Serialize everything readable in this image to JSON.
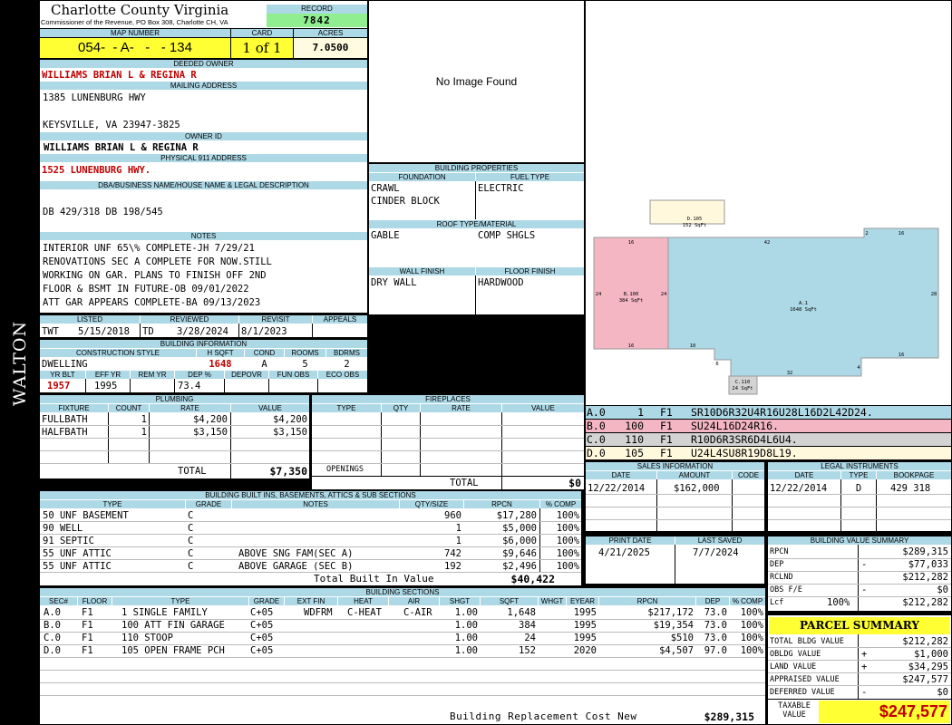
{
  "side_label": "WALTON",
  "header": {
    "county": "Charlotte County Virginia",
    "address": "Commissioner of the Revenue, PO Box 308, Charlotte CH, VA",
    "record_label": "RECORD",
    "record": "7842"
  },
  "map": {
    "map_number_label": "MAP NUMBER",
    "card_label": "CARD",
    "acres_label": "ACRES",
    "map_number": "054-  - A-   -   - 134",
    "card": "1 of 1",
    "acres": "7.0500"
  },
  "owner": {
    "deeded_owner_label": "DEEDED OWNER",
    "deeded_owner": "WILLIAMS BRIAN L & REGINA R",
    "mailing_label": "MAILING ADDRESS",
    "mailing_line1": "1385 LUNENBURG HWY",
    "mailing_line2": "KEYSVILLE, VA 23947-3825",
    "owner_id_label": "OWNER ID",
    "owner_id": "WILLIAMS BRIAN L & REGINA R",
    "physical_label": "PHYSICAL 911 ADDRESS",
    "physical": "1525 LUNENBURG HWY."
  },
  "legal": {
    "label": "DBA/BUSINESS NAME/HOUSE NAME & LEGAL DESCRIPTION",
    "text": "DB 429/318 DB 198/545"
  },
  "notes": {
    "label": "NOTES",
    "lines": [
      "INTERIOR UNF 65\\% COMPLETE-JH 7/29/21",
      "RENOVATIONS SEC A COMPLETE FOR NOW.STILL",
      "WORKING ON GAR. PLANS TO FINISH OFF 2ND",
      "FLOOR & BSMT IN FUTURE-OB 09/01/2022",
      "ATT GAR APPEARS COMPLETE-BA 09/13/2023"
    ]
  },
  "dates": {
    "listed_label": "LISTED",
    "reviewed_label": "REVIEWED",
    "revisit_label": "REVISIT",
    "appeals_label": "APPEALS",
    "listed_by": "TWT",
    "listed": "5/15/2018",
    "reviewed_by": "TD",
    "reviewed": "3/28/2024",
    "revisit": "8/1/2023",
    "appeals": ""
  },
  "building_info": {
    "label": "BUILDING INFORMATION",
    "cs_label": "CONSTRUCTION STYLE",
    "hsqft_label": "H SQFT",
    "cond_label": "COND",
    "rooms_label": "ROOMS",
    "bdrms_label": "BDRMS",
    "style": "DWELLING",
    "hsqft": "1648",
    "cond": "A",
    "rooms": "5",
    "bdrms": "2",
    "yrblt_label": "YR BLT",
    "effyr_label": "EFF YR",
    "remyr_label": "REM YR",
    "dep_label": "DEP %",
    "depovr_label": "DEPOVR",
    "funobs_label": "FUN OBS",
    "ecoobs_label": "ECO OBS",
    "yrblt": "1957",
    "effyr": "1995",
    "remyr": "",
    "dep": "73.4"
  },
  "image": {
    "no_image": "No Image Found"
  },
  "building_props": {
    "label": "BUILDING PROPERTIES",
    "foundation_label": "FOUNDATION",
    "fuel_label": "FUEL TYPE",
    "foundation1": "CRAWL",
    "foundation2": "CINDER BLOCK",
    "fuel": "ELECTRIC",
    "roof_label": "ROOF TYPE/MATERIAL",
    "roof_type": "GABLE",
    "roof_material": "COMP SHGLS",
    "wall_label": "WALL FINISH",
    "floor_label": "FLOOR FINISH",
    "wall": "DRY WALL",
    "floor": "HARDWOOD"
  },
  "sketch": {
    "areas": [
      {
        "id": "D.105",
        "sqft": "152 SqFt",
        "color": "#fff8dc"
      },
      {
        "id": "B.100",
        "sqft": "384 SqFt",
        "color": "#f4b6c2"
      },
      {
        "id": "A.1",
        "sqft": "1648 SqFt",
        "color": "#add8e6"
      },
      {
        "id": "C.110",
        "sqft": "24 SqFt",
        "color": "#d3d3d3"
      }
    ],
    "dims": [
      "16",
      "42",
      "2",
      "16",
      "24",
      "24",
      "28",
      "16",
      "10",
      "16",
      "6",
      "32",
      "4",
      "16",
      "16"
    ]
  },
  "sketch_codes": [
    {
      "sec": "A.0",
      "code": "1",
      "floor": "F1",
      "vectors": "SR10D6R32U4R16U28L16D2L42D24.",
      "color": "#add8e6"
    },
    {
      "sec": "B.0",
      "code": "100",
      "floor": "F1",
      "vectors": "SU24L16D24R16.",
      "color": "#f4b6c2"
    },
    {
      "sec": "C.0",
      "code": "110",
      "floor": "F1",
      "vectors": "R10D6R3SR6D4L6U4.",
      "color": "#d3d3d3"
    },
    {
      "sec": "D.0",
      "code": "105",
      "floor": "F1",
      "vectors": "U24L4SU8R19D8L19.",
      "color": "#fff8dc"
    }
  ],
  "plumbing": {
    "label": "PLUMBING",
    "cols": [
      "FIXTURE",
      "COUNT",
      "RATE",
      "VALUE"
    ],
    "rows": [
      [
        "FULLBATH",
        "1",
        "$4,200",
        "$4,200"
      ],
      [
        "HALFBATH",
        "1",
        "$3,150",
        "$3,150"
      ]
    ],
    "total_label": "TOTAL",
    "total": "$7,350"
  },
  "fireplaces": {
    "label": "FIREPLACES",
    "cols": [
      "TYPE",
      "QTY",
      "RATE",
      "VALUE"
    ],
    "openings_label": "OPENINGS",
    "total_label": "TOTAL",
    "total": "$0"
  },
  "sales": {
    "label": "SALES INFORMATION",
    "cols": [
      "DATE",
      "AMOUNT",
      "CODE"
    ],
    "rows": [
      [
        "12/22/2014",
        "$162,000",
        ""
      ]
    ]
  },
  "legal_instruments": {
    "label": "LEGAL INSTRUMENTS",
    "cols": [
      "DATE",
      "TYPE",
      "BOOKPAGE"
    ],
    "rows": [
      [
        "12/22/2014",
        "D",
        "429 318"
      ]
    ]
  },
  "print": {
    "print_label": "PRINT DATE",
    "saved_label": "LAST SAVED",
    "print_date": "4/21/2025",
    "last_saved": "7/7/2024"
  },
  "builtins": {
    "label": "BUILDING BUILT INS, BASEMENTS, ATTICS & SUB SECTIONS",
    "cols": [
      "TYPE",
      "GRADE",
      "NOTES",
      "QTY/SIZE",
      "RPCN",
      "% COMP"
    ],
    "rows": [
      [
        "50 UNF BASEMENT",
        "C",
        "",
        "960",
        "$17,280",
        "100%"
      ],
      [
        "90 WELL",
        "C",
        "",
        "1",
        "$5,000",
        "100%"
      ],
      [
        "91 SEPTIC",
        "C",
        "",
        "1",
        "$6,000",
        "100%"
      ],
      [
        "55 UNF ATTIC",
        "C",
        "ABOVE SNG FAM(SEC A)",
        "742",
        "$9,646",
        "100%"
      ],
      [
        "55 UNF ATTIC",
        "C",
        "ABOVE GARAGE (SEC B)",
        "192",
        "$2,496",
        "100%"
      ]
    ],
    "total_label": "Total Built In Value",
    "total": "$40,422"
  },
  "value_summary": {
    "label": "BUILDING VALUE SUMMARY",
    "rows": [
      {
        "label": "RPCN",
        "sign": "",
        "value": "$289,315"
      },
      {
        "label": "DEP",
        "sign": "-",
        "value": "$77,033"
      },
      {
        "label": "RCLND",
        "sign": "",
        "value": "$212,282"
      },
      {
        "label": "OBS F/E",
        "sign": "-",
        "value": "$0"
      },
      {
        "label": "Lcf",
        "sign": "100%",
        "value": "$212,282"
      }
    ]
  },
  "sections": {
    "label": "BUILDING SECTIONS",
    "cols": [
      "SEC#",
      "FLOOR",
      "TYPE",
      "GRADE",
      "EXT FIN",
      "HEAT",
      "AIR",
      "SHGT",
      "SQFT",
      "WHGT",
      "EYEAR",
      "RPCN",
      "DEP",
      "% COMP"
    ],
    "rows": [
      [
        "A.0",
        "F1",
        "1 SINGLE FAMILY",
        "C+05",
        "WDFRM",
        "C-HEAT",
        "C-AIR",
        "1.00",
        "1,648",
        "",
        "1995",
        "$217,172",
        "73.0",
        "100%"
      ],
      [
        "B.0",
        "F1",
        "100 ATT FIN GARAGE",
        "C+05",
        "",
        "",
        "",
        "1.00",
        "384",
        "",
        "1995",
        "$19,354",
        "73.0",
        "100%"
      ],
      [
        "C.0",
        "F1",
        "110 STOOP",
        "C+05",
        "",
        "",
        "",
        "1.00",
        "24",
        "",
        "1995",
        "$510",
        "73.0",
        "100%"
      ],
      [
        "D.0",
        "F1",
        "105 OPEN FRAME PCH",
        "C+05",
        "",
        "",
        "",
        "1.00",
        "152",
        "",
        "2020",
        "$4,507",
        "97.0",
        "100%"
      ]
    ],
    "brcn_label": "Building Replacement Cost New",
    "brcn": "$289,315"
  },
  "parcel": {
    "label": "PARCEL SUMMARY",
    "rows": [
      {
        "label": "TOTAL BLDG VALUE",
        "sign": "",
        "value": "$212,282"
      },
      {
        "label": "OBLDG VALUE",
        "sign": "+",
        "value": "$1,000"
      },
      {
        "label": "LAND VALUE",
        "sign": "+",
        "value": "$34,295"
      },
      {
        "label": "APPRAISED VALUE",
        "sign": "",
        "value": "$247,577"
      },
      {
        "label": "DEFERRED VALUE",
        "sign": "-",
        "value": "$0"
      }
    ],
    "taxable_label": "TAXABLE VALUE",
    "taxable": "$247,577"
  }
}
